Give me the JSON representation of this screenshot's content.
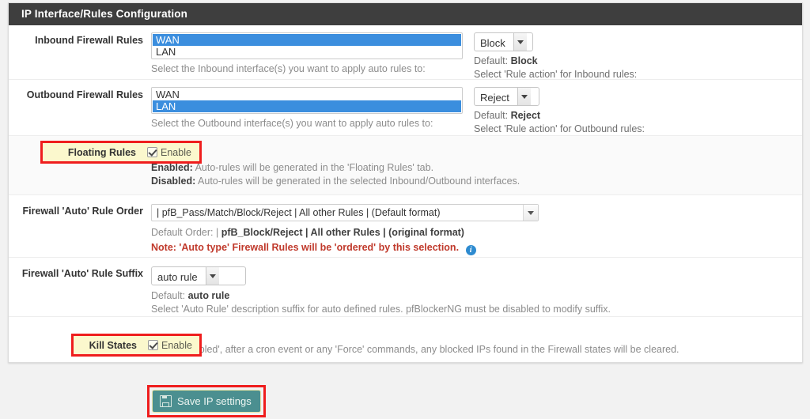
{
  "panel": {
    "title": "IP Interface/Rules Configuration"
  },
  "colors": {
    "header_bg": "#3e3e3e",
    "highlight_border": "#ef1d1d",
    "highlight_bg": "#fbf8cd",
    "listbox_selection": "#3b8ede",
    "note_red": "#c0392b",
    "save_button_bg": "#4b8f90",
    "page_bg": "#f2f2f2"
  },
  "rows": {
    "inbound": {
      "label": "Inbound Firewall Rules",
      "options": [
        {
          "text": "WAN",
          "selected": true
        },
        {
          "text": "LAN",
          "selected": false
        }
      ],
      "help": "Select the Inbound interface(s) you want to apply auto rules to:",
      "action_value": "Block",
      "action_default_prefix": "Default:",
      "action_default_value": "Block",
      "action_help": "Select 'Rule action' for Inbound rules:"
    },
    "outbound": {
      "label": "Outbound Firewall Rules",
      "options": [
        {
          "text": "WAN",
          "selected": false
        },
        {
          "text": "LAN",
          "selected": true
        }
      ],
      "help": "Select the Outbound interface(s) you want to apply auto rules to:",
      "action_value": "Reject",
      "action_default_prefix": "Default:",
      "action_default_value": "Reject",
      "action_help": "Select 'Rule action' for Outbound rules:"
    },
    "floating_rules": {
      "label": "Floating Rules",
      "checkbox_label": "Enable",
      "checked": true,
      "help_enabled_key": "Enabled:",
      "help_enabled_text": " Auto-rules will be generated in the 'Floating Rules' tab.",
      "help_disabled_key": "Disabled:",
      "help_disabled_text": " Auto-rules will be generated in the selected Inbound/Outbound interfaces."
    },
    "rule_order": {
      "label": "Firewall 'Auto' Rule Order",
      "value": "| pfB_Pass/Match/Block/Reject | All other Rules | (Default format)",
      "default_prefix": "Default Order: | ",
      "default_value": "pfB_Block/Reject | All other Rules | (original format)",
      "note": "Note: 'Auto type' Firewall Rules will be 'ordered' by this selection.",
      "info_icon": "info-icon"
    },
    "rule_suffix": {
      "label": "Firewall 'Auto' Rule Suffix",
      "value": "auto rule",
      "default_prefix": "Default:",
      "default_value": "auto rule",
      "help": "Select 'Auto Rule' description suffix for auto defined rules. pfBlockerNG must be disabled to modify suffix."
    },
    "kill_states": {
      "label": "Kill States",
      "checkbox_label": "Enable",
      "checked": true,
      "help": "When 'Enabled', after a cron event or any 'Force' commands, any blocked IPs found in the Firewall states will be cleared."
    }
  },
  "footer": {
    "save_label": "Save IP settings",
    "save_icon": "floppy-disk-icon"
  }
}
